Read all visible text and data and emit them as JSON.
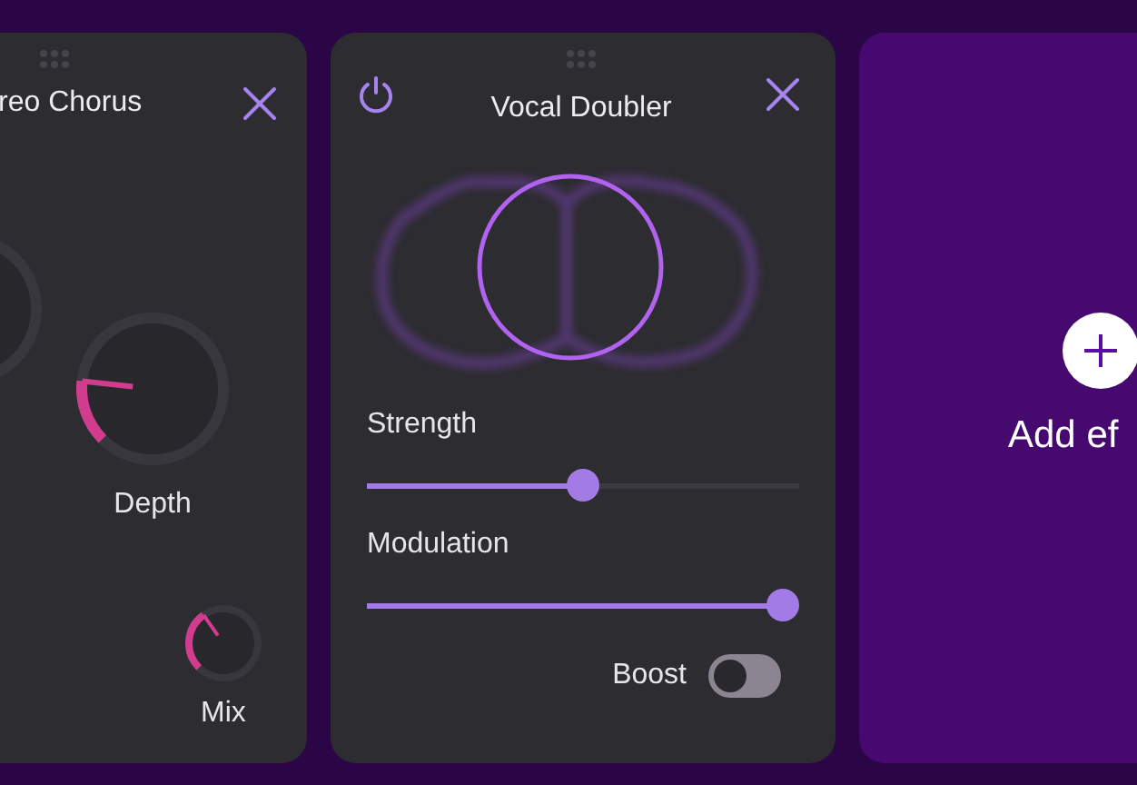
{
  "effects": [
    {
      "kind": "chorus",
      "title": "reo Chorus",
      "knobs": [
        {
          "kind": "cut"
        },
        {
          "kind": "large",
          "label": "Depth",
          "level": 0.19
        },
        {
          "kind": "small",
          "label": "Mix",
          "level": 0.37
        }
      ]
    },
    {
      "kind": "doubler",
      "title": "Vocal Doubler",
      "power": {
        "on": true
      },
      "sliders": [
        {
          "label": "Strength",
          "level": 0.5
        },
        {
          "label": "Modulation",
          "level": 1
        }
      ],
      "toggles": [
        {
          "label": "Boost",
          "on": false
        }
      ]
    }
  ],
  "add_card": {
    "label": "Add ef"
  }
}
